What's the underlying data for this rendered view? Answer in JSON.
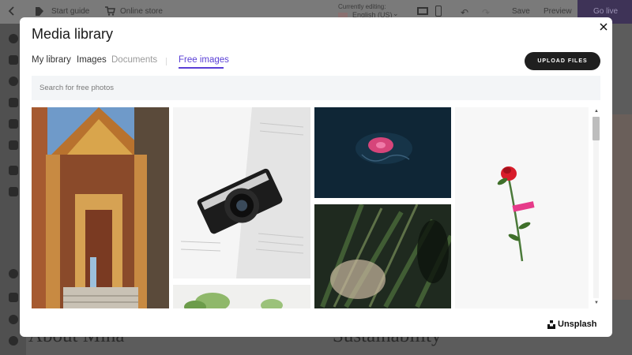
{
  "app": {
    "topbar": {
      "start_guide": "Start guide",
      "online_store": "Online store",
      "editing_label": "Currently editing:",
      "language": "English (US)",
      "save": "Save",
      "preview": "Preview",
      "go_live": "Go live"
    },
    "background_headings": [
      "About Mina",
      "Sustainability"
    ]
  },
  "modal": {
    "title": "Media library",
    "tabs": [
      {
        "label": "My library",
        "state": "normal"
      },
      {
        "label": "Images",
        "state": "normal"
      },
      {
        "label": "Documents",
        "state": "disabled"
      },
      {
        "label": "Free images",
        "state": "active"
      }
    ],
    "upload_button": "UPLOAD FILES",
    "search": {
      "placeholder": "Search for free photos",
      "value": ""
    },
    "photos": [
      {
        "subject": "thai-temple-doorway"
      },
      {
        "subject": "camera-on-open-book"
      },
      {
        "subject": "glowing-jellyfish"
      },
      {
        "subject": "blurred-grass-closeup"
      },
      {
        "subject": "red-rose-on-white"
      },
      {
        "subject": "green-plant-partial"
      }
    ],
    "provider": "Unsplash",
    "accent_color": "#5a3fd6"
  }
}
